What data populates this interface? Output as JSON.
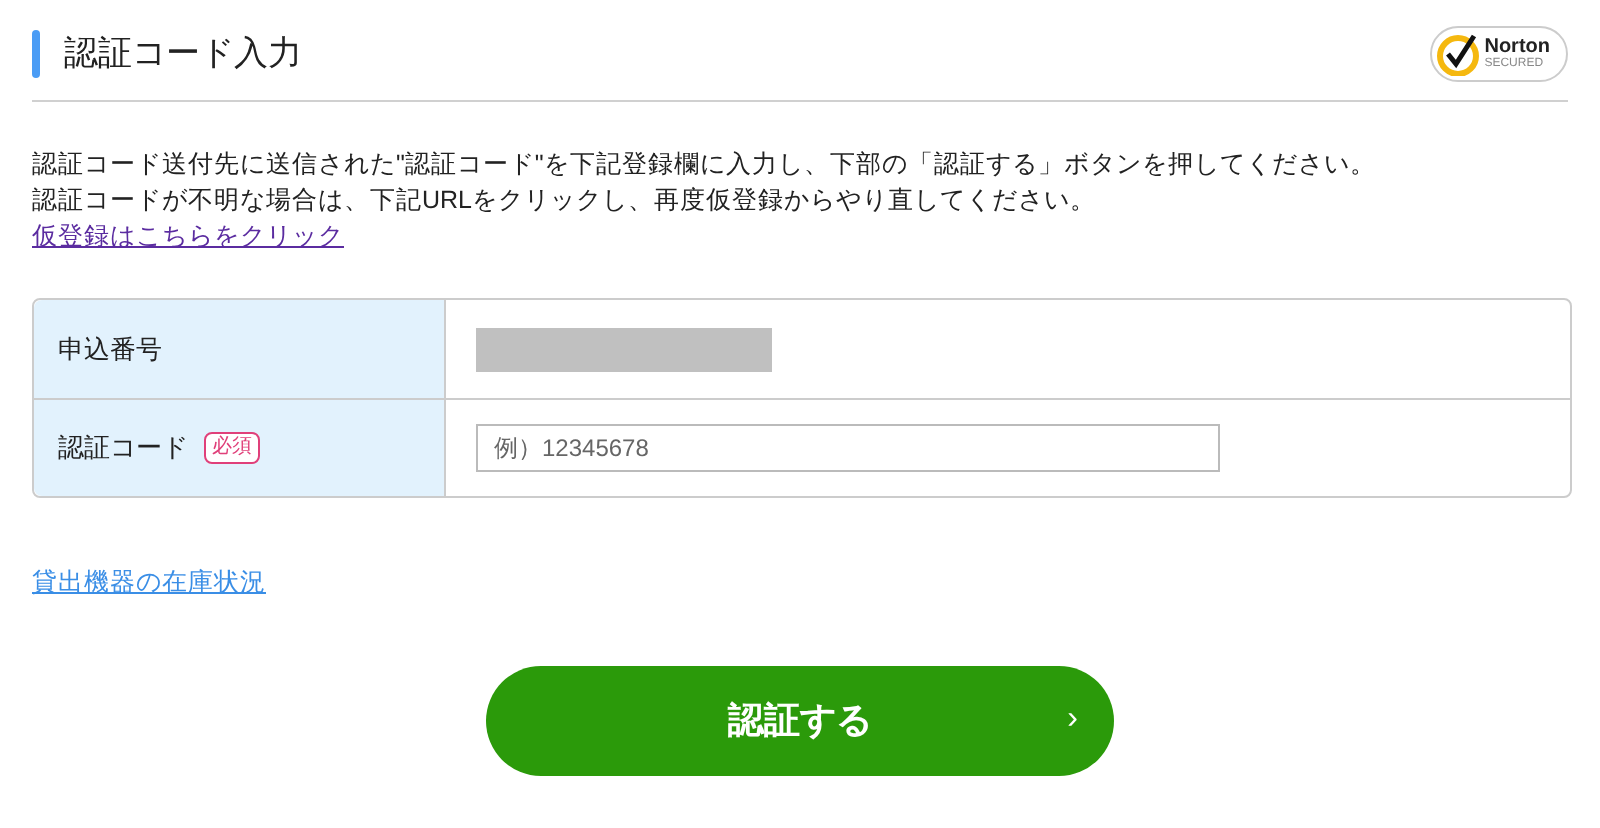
{
  "header": {
    "title": "認証コード入力",
    "badge": {
      "brand": "Norton",
      "caption": "SECURED"
    }
  },
  "instructions": [
    "認証コード送付先に送信された\"認証コード\"を下記登録欄に入力し、下部の「認証する」ボタンを押してください。",
    "認証コードが不明な場合は、下記URLをクリックし、再度仮登録からやり直してください。"
  ],
  "retry_link": "仮登録はこちらをクリック",
  "form": {
    "rows": [
      {
        "kind": "redacted",
        "label": "申込番号"
      },
      {
        "kind": "input",
        "label": "認証コード",
        "required_tag": "必須",
        "placeholder": "例）12345678"
      }
    ]
  },
  "stock_link": "貸出機器の在庫状況",
  "submit": {
    "label": "認証する",
    "chevron": "›"
  }
}
